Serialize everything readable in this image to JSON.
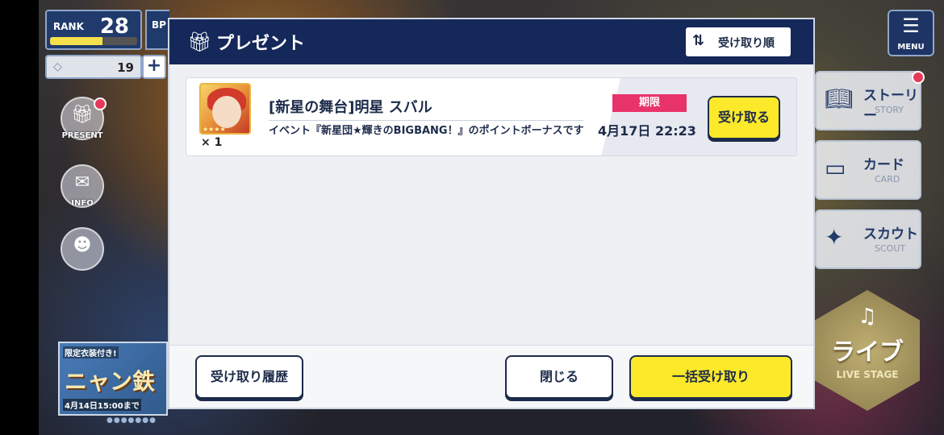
{
  "hud": {
    "rank_label": "RANK",
    "rank_value": "28",
    "rank_progress": 0.6,
    "bp_label": "BP",
    "gem_value": "19",
    "plus": "+"
  },
  "left_menu": {
    "present_label": "PRESENT",
    "info_label": "INFO"
  },
  "banner": {
    "tag": "限定衣装付き!",
    "title": "ニャン鉄",
    "date": "4月14日15:00まで",
    "dots": "●●●●●●●"
  },
  "right_menu": {
    "menu_label": "MENU",
    "story_jp": "ストーリー",
    "story_en": "STORY",
    "card_jp": "カード",
    "card_en": "CARD",
    "scout_jp": "スカウト",
    "scout_en": "SCOUT",
    "live_jp": "ライブ",
    "live_en": "LIVE STAGE"
  },
  "dialog": {
    "title": "プレゼント",
    "sort_label": "受け取り順",
    "items": [
      {
        "name": "[新星の舞台]明星 スバル",
        "quantity": "× 1",
        "description": "イベント『新星団★輝きのBIGBANG！』のポイントボーナスです",
        "deadline_label": "期限",
        "deadline": "4月17日 22:23",
        "receive_label": "受け取る"
      }
    ],
    "history_label": "受け取り履歴",
    "close_label": "閉じる",
    "receive_all_label": "一括受け取り"
  },
  "colors": {
    "header_navy": "#15285a",
    "accent_yellow": "#fbe92a",
    "deadline_pink": "#e8336a",
    "text_navy": "#1d2b4a"
  }
}
